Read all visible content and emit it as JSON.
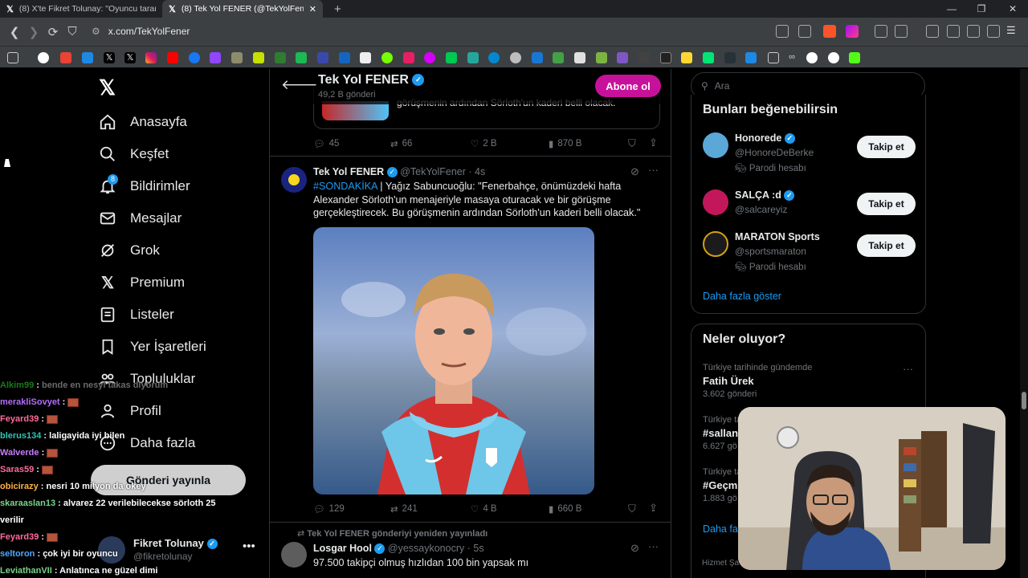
{
  "browser": {
    "tabs": [
      {
        "title": "(8) X'te Fikret Tolunay: \"Oyuncu taran"
      },
      {
        "title": "(8) Tek Yol FENER (@TekYolFener)"
      }
    ],
    "url": "x.com/TekYolFener"
  },
  "sidebar": {
    "notifications_badge": "8",
    "items": [
      {
        "label": "Anasayfa",
        "icon": "home-icon"
      },
      {
        "label": "Keşfet",
        "icon": "search-icon"
      },
      {
        "label": "Bildirimler",
        "icon": "bell-icon"
      },
      {
        "label": "Mesajlar",
        "icon": "mail-icon"
      },
      {
        "label": "Grok",
        "icon": "grok-icon"
      },
      {
        "label": "Premium",
        "icon": "x-logo-icon"
      },
      {
        "label": "Listeler",
        "icon": "list-icon"
      },
      {
        "label": "Yer İşaretleri",
        "icon": "bookmark-icon"
      },
      {
        "label": "Topluluklar",
        "icon": "communities-icon"
      },
      {
        "label": "Profil",
        "icon": "person-icon"
      },
      {
        "label": "Daha fazla",
        "icon": "more-circle-icon"
      }
    ],
    "post_button": "Gönderi yayınla",
    "account": {
      "name": "Fikret Tolunay",
      "handle": "@fikretolunay"
    }
  },
  "profile_header": {
    "name": "Tek Yol FENER",
    "posts": "49,2 B gönderi",
    "subscribe": "Abone ol"
  },
  "tweets": [
    {
      "partial_text": "görüşmenin ardından Sörloth'un kaderi belli olacak.",
      "replies": "45",
      "retweets": "66",
      "likes": "2 B",
      "views": "870 B"
    },
    {
      "name": "Tek Yol FENER",
      "handle": "@TekYolFener",
      "time": "4s",
      "hashtag": "#SONDAKİKA",
      "text": " | Yağız Sabuncuoğlu: \"Fenerbahçe, önümüzdeki hafta Alexander Sörloth'un menajeriyle masaya oturacak ve bir görüşme gerçekleştirecek. Bu görüşmenin ardından Sörloth'un kaderi belli olacak.\"",
      "replies": "129",
      "retweets": "241",
      "likes": "4 B",
      "views": "660 B"
    },
    {
      "retweeted_by": "Tek Yol FENER gönderiyi yeniden yayınladı",
      "name": "Losgar Hool",
      "handle": "@yessaykonocry",
      "time": "5s",
      "text": "97.500 takipçi olmuş hızlıdan 100 bin yapsak mı"
    }
  ],
  "search": {
    "placeholder": "Ara"
  },
  "suggestions": {
    "title": "Bunları beğenebilirsin",
    "items": [
      {
        "name": "Honorede",
        "handle": "@HonoreDeBerke",
        "badge": "Parodi hesabı",
        "button": "Takip et"
      },
      {
        "name": "SALÇA :d",
        "handle": "@salcareyiz",
        "badge": "",
        "button": "Takip et"
      },
      {
        "name": "MARATON Sports",
        "handle": "@sportsmaraton",
        "badge": "Parodi hesabı",
        "button": "Takip et"
      }
    ],
    "more": "Daha fazla göster"
  },
  "trends": {
    "title": "Neler oluyor?",
    "items": [
      {
        "context": "Türkiye tarihinde gündemde",
        "name": "Fatih Ürek",
        "count": "3.602 gönderi"
      },
      {
        "context": "Türkiye ta",
        "name": "#sallan",
        "count": "6.627 gö"
      },
      {
        "context": "Türkiye ta",
        "name": "#Geçmi",
        "count": "1.883 gö"
      }
    ],
    "more": "Daha fa",
    "footer": "Hizmet Şa"
  },
  "chat": [
    {
      "user": "Alkim99",
      "msg": "bende en nesyi takas diyorum",
      "color": "#1a7a1a"
    },
    {
      "user": "merakliSovyet",
      "msg": "",
      "color": "#b46cff",
      "emote": true
    },
    {
      "user": "Feyard39",
      "msg": "",
      "color": "#ff6b9a",
      "emote": true
    },
    {
      "user": "blerus134",
      "msg": "laligayida iyi bilen",
      "color": "#2ec4b6"
    },
    {
      "user": "Walverde",
      "msg": "",
      "color": "#c77dff",
      "emote": true
    },
    {
      "user": "Saras59",
      "msg": "",
      "color": "#ff6b9a",
      "emote": true
    },
    {
      "user": "obicirazy",
      "msg": "nesri 10 milyon da okey",
      "color": "#ffb347"
    },
    {
      "user": "skaraaslan13",
      "msg": "alvarez 22 verilebilecekse sörloth 25",
      "color": "#7bd389"
    },
    {
      "user": "",
      "msg": "verilir",
      "color": "#ffffff"
    },
    {
      "user": "Feyard39",
      "msg": "",
      "color": "#ff6b9a",
      "emote": true
    },
    {
      "user": "seltoron",
      "msg": "çok iyi bir oyuncu",
      "color": "#4ea8ff"
    },
    {
      "user": "LeviathanVII",
      "msg": "Anlatınca ne güzel dimi",
      "color": "#7bd389"
    }
  ]
}
